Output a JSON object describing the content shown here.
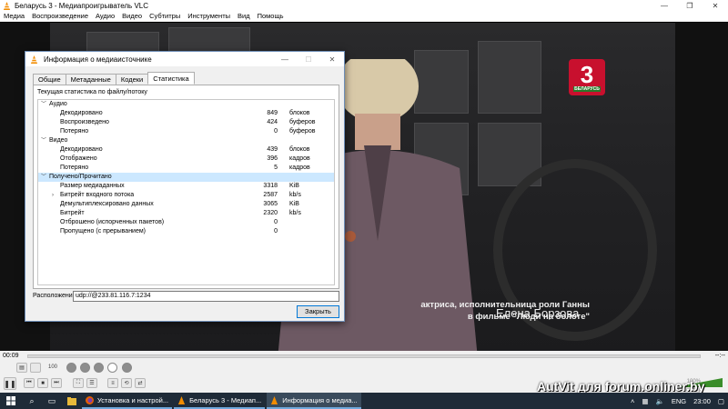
{
  "window": {
    "title": "Беларусь 3 - Медиапроигрыватель VLC",
    "menu": [
      "Медиа",
      "Воспроизведение",
      "Аудио",
      "Видео",
      "Субтитры",
      "Инструменты",
      "Вид",
      "Помощь"
    ]
  },
  "video": {
    "channel_number": "3",
    "channel_name": "БЕЛАРУСЬ",
    "caption_name": "Елена Борзова",
    "caption_line1": "актриса, исполнительница роли Ганны",
    "caption_line2": "в фильме \"Люди на болоте\""
  },
  "dialog": {
    "title": "Информация о медиаисточнике",
    "tabs": [
      "Общие",
      "Метаданные",
      "Кодеки",
      "Статистика"
    ],
    "active_tab": "Статистика",
    "panel_label": "Текущая статистика по файлу/потоку",
    "groups": [
      {
        "name": "Аудио",
        "rows": [
          {
            "label": "Декодировано",
            "value": "849",
            "unit": "блоков"
          },
          {
            "label": "Воспроизведено",
            "value": "424",
            "unit": "буферов"
          },
          {
            "label": "Потеряно",
            "value": "0",
            "unit": "буферов"
          }
        ]
      },
      {
        "name": "Видео",
        "rows": [
          {
            "label": "Декодировано",
            "value": "439",
            "unit": "блоков"
          },
          {
            "label": "Отображено",
            "value": "396",
            "unit": "кадров"
          },
          {
            "label": "Потеряно",
            "value": "5",
            "unit": "кадров"
          }
        ]
      },
      {
        "name": "Получено/Прочитано",
        "rows": [
          {
            "label": "Размер медиаданных",
            "value": "3318",
            "unit": "KiB"
          },
          {
            "label": "Битрейт входного потока",
            "value": "2587",
            "unit": "kb/s"
          },
          {
            "label": "Демультиплексировано данных",
            "value": "3065",
            "unit": "KiB"
          },
          {
            "label": "Битрейт",
            "value": "2320",
            "unit": "kb/s"
          },
          {
            "label": "Отброшено (испорченных пакетов)",
            "value": "0",
            "unit": ""
          },
          {
            "label": "Пропущено (с прерыванием)",
            "value": "0",
            "unit": ""
          }
        ]
      }
    ],
    "location_label": "Расположение:",
    "location_value": "udp://@233.81.116.7:1234",
    "close_label": "Закрыть"
  },
  "player": {
    "time_elapsed": "00:09",
    "time_total": "--:--",
    "progress": 0.0,
    "speed_value": "100",
    "volume_percent": "100%",
    "watermark": "AutVit для forum.onliner.by"
  },
  "taskbar": {
    "items": [
      {
        "label": "Установка и настрой...",
        "icon": "firefox-icon",
        "active": false
      },
      {
        "label": "Беларусь 3 - Медиап...",
        "icon": "vlc-icon",
        "active": false
      },
      {
        "label": "Информация о медиа...",
        "icon": "vlc-icon",
        "active": true
      }
    ],
    "language": "ENG",
    "clock": "23:00"
  },
  "colors": {
    "vlc_orange": "#f28c00",
    "selection": "#cce8ff",
    "taskbar": "#1f2b38",
    "channel_red": "#c8102e"
  }
}
